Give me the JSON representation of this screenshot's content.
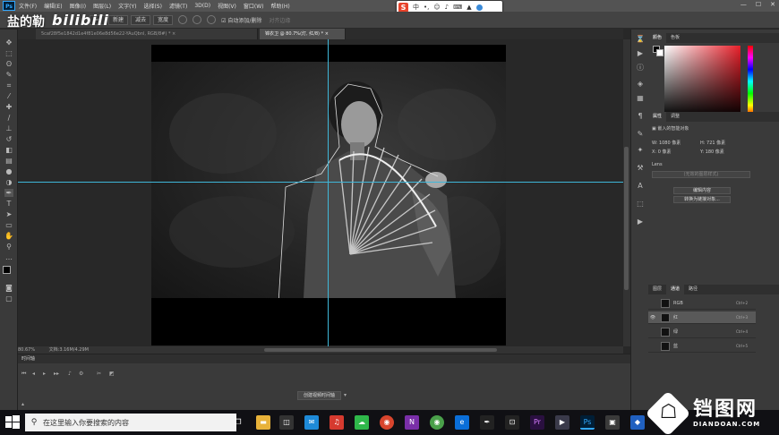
{
  "menubar": {
    "app_logo": "Ps",
    "items": [
      "文件(F)",
      "编辑(E)",
      "图像(I)",
      "图层(L)",
      "文字(Y)",
      "选择(S)",
      "滤镜(T)",
      "3D(D)",
      "视图(V)",
      "窗口(W)",
      "帮助(H)"
    ]
  },
  "watermark": {
    "text": "盐的勒",
    "brand": "bilibili"
  },
  "ime": {
    "mode": "中"
  },
  "options": {
    "new_label": "新建",
    "subtract_label": "减去",
    "width_label": "宽度",
    "auto_add_label": "自动添加/删除",
    "align_label": "对齐边缘"
  },
  "tabs": [
    {
      "label": "5caf28f5e1842d1e4f81e06e8d56e22-YAuQbnl, RGB/8#) *  ×",
      "active": false
    },
    {
      "label": "锦衣卫 @ 80.7%(灯, 红/8) *  ×",
      "active": true
    }
  ],
  "status": {
    "zoom": "80.67%",
    "doc": "文档:3.16M/4.29M"
  },
  "timeline": {
    "title": "时间轴",
    "create_button": "创建视频时间轴"
  },
  "color_panel": {
    "tabs": [
      "颜色",
      "色板"
    ]
  },
  "properties_panel": {
    "tabs": [
      "属性",
      "调整"
    ],
    "object_label": "嵌入的智能对象",
    "w_label": "W:",
    "w_value": "1080 像素",
    "h_label": "H:",
    "h_value": "721 像素",
    "x_label": "X:",
    "x_value": "0 像素",
    "y_label": "Y:",
    "y_value": "180 像素",
    "layer_name": "Lens",
    "placeholder": "(无效的图层样式)",
    "edit_button": "编辑内容",
    "convert_button": "转换为链接对象..."
  },
  "channels_panel": {
    "tabs": [
      "图层",
      "通道",
      "路径"
    ],
    "rows": [
      {
        "name": "RGB",
        "shortcut": "Ctrl+2",
        "selected": false
      },
      {
        "name": "红",
        "shortcut": "Ctrl+3",
        "selected": true
      },
      {
        "name": "绿",
        "shortcut": "Ctrl+4",
        "selected": false
      },
      {
        "name": "蓝",
        "shortcut": "Ctrl+5",
        "selected": false
      }
    ]
  },
  "taskbar": {
    "search_placeholder": "在这里输入你要搜索的内容"
  },
  "site_logo": {
    "name": "铛图网",
    "url": "DIANDOAN.COM"
  },
  "colors": {
    "guide": "#3fb7d9",
    "accent": "#31a8ff"
  }
}
